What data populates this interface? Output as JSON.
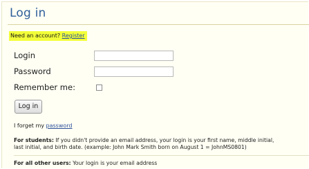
{
  "page": {
    "title": "Log in"
  },
  "signup": {
    "prompt": "Need an account?",
    "register_link": "Register"
  },
  "form": {
    "login_label": "Login",
    "login_value": "",
    "password_label": "Password",
    "password_value": "",
    "remember_label": "Remember me:",
    "remember_checked": false,
    "submit_label": "Log in"
  },
  "forgot": {
    "prefix": "I forget my",
    "link": "password"
  },
  "students_note": {
    "label": "For students:",
    "line1": "If you didn't provide an email address, your login is your first name, middle initial,",
    "line2": "last initial, and birth date. (example: John Mark Smith born on August 1 = JohnMS0801)"
  },
  "others_note": {
    "label": "For all other users:",
    "text": "Your login is your email address"
  },
  "colors": {
    "title": "#2f5f9a",
    "highlight": "#f3ff3a",
    "link": "#2a4f9a",
    "panel_bg": "#fffff4"
  }
}
